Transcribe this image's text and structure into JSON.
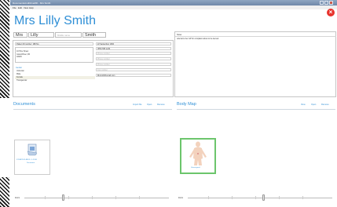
{
  "window": {
    "title": "DocumentsAndDriveMD - Mrs Smith"
  },
  "menu": [
    "File",
    "Edit",
    "View",
    "Help"
  ],
  "patient": {
    "display_name": "Mrs Lilly Smith",
    "title": "Mrs",
    "first_name": "Lilly",
    "middle_placeholder": "Middle name",
    "last_name": "Smith"
  },
  "details": {
    "id_line": "Patient ID number: 188 No.",
    "address": [
      "10 Pine Street",
      "Grand River, PA",
      "18245"
    ],
    "gender_label": "Gender",
    "gender_options": [
      "Unknown",
      "Male",
      "Female",
      "Transgender"
    ],
    "gender_selected": "Female",
    "dob": "22 September 1964",
    "phone": "(555) 555 1234",
    "ph_mobile": "Phone number",
    "ph_mobile2": "Phone number",
    "ph_work": "Phone number",
    "ph_fax": "Fax number",
    "email": "lillysmith@email.com"
  },
  "notes": {
    "label": "Notes",
    "text": "referral to her GP for complaint about to be itemed"
  },
  "documents": {
    "title": "Documents",
    "actions": [
      "Import file",
      "Open",
      "Remove"
    ],
    "items": [
      {
        "name": "ST-BBTI-ID-RECL-1 -2016",
        "sub": "Document"
      }
    ],
    "zoom_label": "Zoom"
  },
  "body_map": {
    "title": "Body Map",
    "actions": [
      "View",
      "Open",
      "Remove"
    ],
    "items": [
      {
        "name": "Unassigned"
      }
    ],
    "zoom_label": "Zoom"
  },
  "colors": {
    "accent": "#2f8fd6",
    "close": "#e8322c",
    "selected_border": "#6cc56c"
  }
}
